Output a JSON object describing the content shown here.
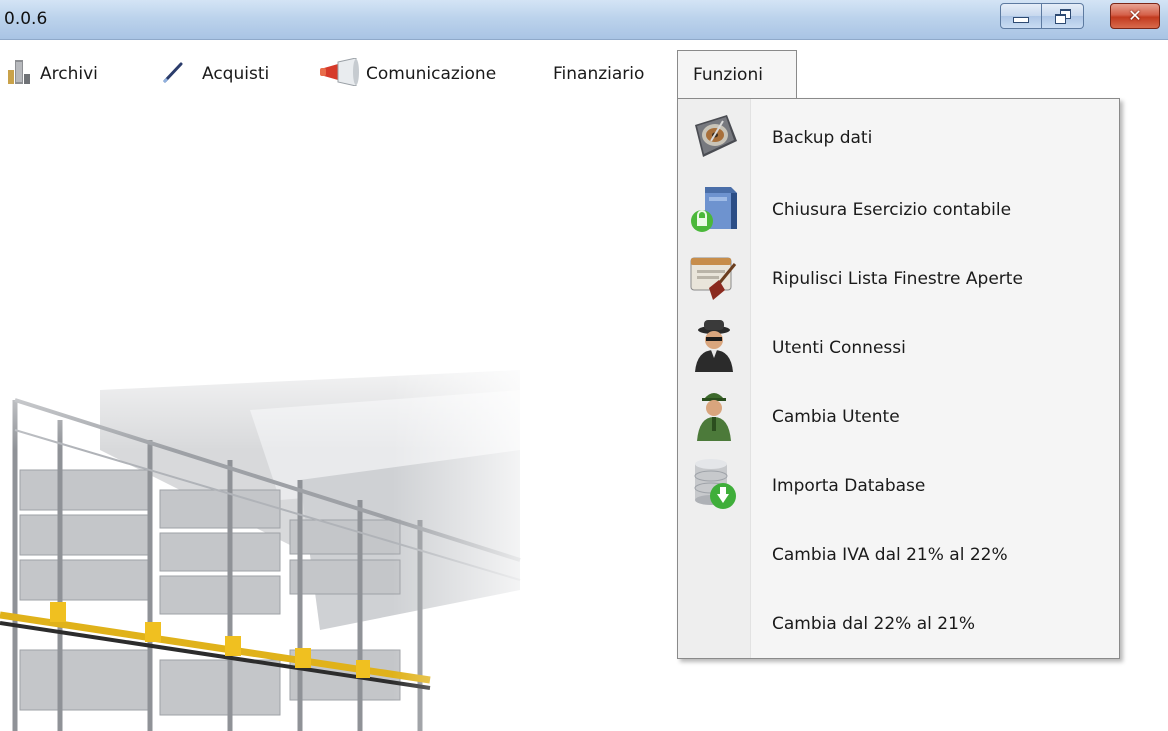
{
  "window": {
    "title": "0.0.6",
    "controls": [
      "minimize",
      "restore",
      "close"
    ],
    "close_glyph": "✕"
  },
  "menubar": {
    "items": [
      {
        "label": "Archivi",
        "icon": "binder-icon"
      },
      {
        "label": "Acquisti",
        "icon": "pen-icon"
      },
      {
        "label": "Comunicazione",
        "icon": "megaphone-icon"
      },
      {
        "label": "Finanziario",
        "icon": ""
      },
      {
        "label": "Funzioni",
        "icon": "",
        "open": true
      }
    ]
  },
  "dropdown": {
    "items": [
      {
        "label": "Backup dati",
        "icon": "hard-disk-icon"
      },
      {
        "label": "Chiusura Esercizio contabile",
        "icon": "server-lock-icon"
      },
      {
        "label": "Ripulisci Lista Finestre Aperte",
        "icon": "window-broom-icon"
      },
      {
        "label": "Utenti Connessi",
        "icon": "spy-user-icon"
      },
      {
        "label": "Cambia Utente",
        "icon": "soldier-user-icon"
      },
      {
        "label": "Importa Database",
        "icon": "database-import-icon"
      },
      {
        "label": "Cambia IVA dal 21% al 22%",
        "icon": ""
      },
      {
        "label": "Cambia dal 22% al 21%",
        "icon": ""
      }
    ]
  },
  "colors": {
    "titlebar": "#bcd3ec",
    "close_button": "#c23a1f",
    "menu_background": "#f5f5f5",
    "menu_border": "#8a8a8a"
  }
}
